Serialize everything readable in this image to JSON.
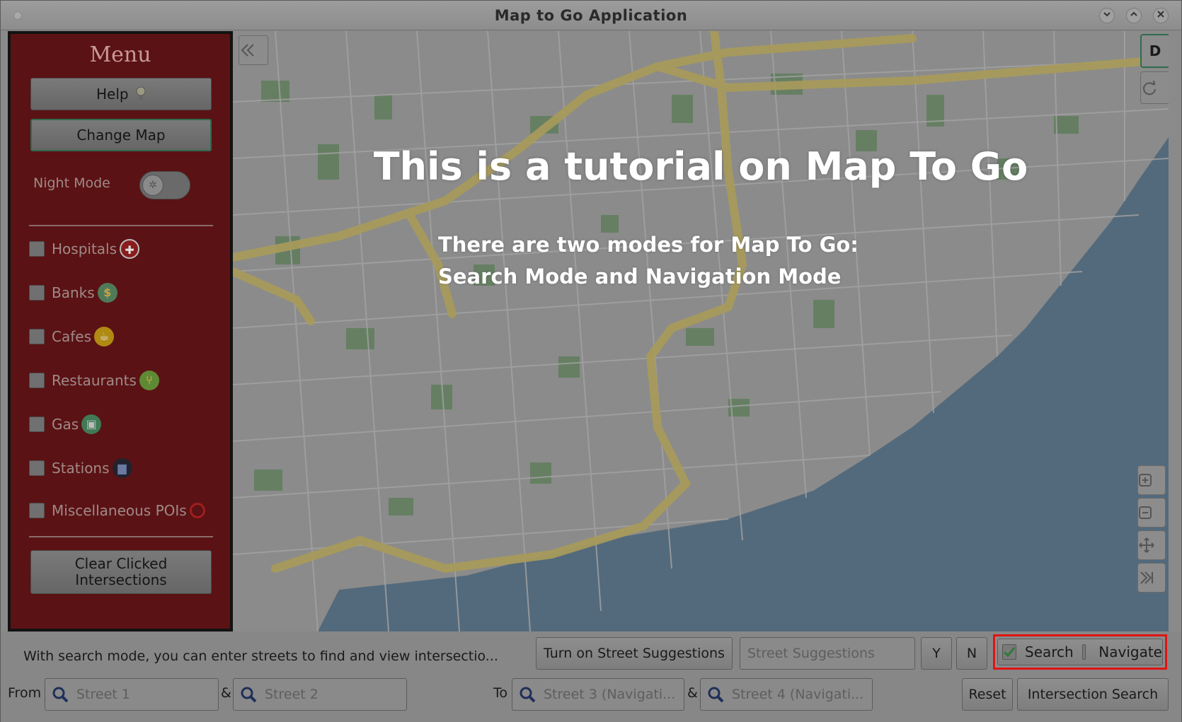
{
  "window": {
    "title": "Map to Go Application"
  },
  "sidebar": {
    "title": "Menu",
    "help_label": "Help",
    "change_map_label": "Change Map",
    "night_mode_label": "Night Mode",
    "pois": [
      {
        "label": "Hospitals",
        "icon": "hospital-icon",
        "color": "#a01e1e"
      },
      {
        "label": "Banks",
        "icon": "money-bag-icon",
        "color": "#5f8a5a"
      },
      {
        "label": "Cafes",
        "icon": "coffee-cup-icon",
        "color": "#b08a12"
      },
      {
        "label": "Restaurants",
        "icon": "fork-knife-icon",
        "color": "#5f8a35"
      },
      {
        "label": "Gas",
        "icon": "gas-pump-icon",
        "color": "#3f7a55"
      },
      {
        "label": "Stations",
        "icon": "train-icon",
        "color": "#2a2a3a"
      },
      {
        "label": "Miscellaneous POIs",
        "icon": "circle-marker-icon",
        "color": "#a01e1e"
      }
    ],
    "clear_label_line1": "Clear Clicked",
    "clear_label_line2": "Intersections"
  },
  "map": {
    "d_label": "D",
    "overlay_title": "This is a tutorial on Map To Go",
    "overlay_line1": "There are two modes for Map To Go:",
    "overlay_line2": "Search Mode and Navigation Mode"
  },
  "bottom": {
    "info_text": "With search mode, you can enter streets to find and view intersectio...",
    "suggestions_button": "Turn on Street Suggestions",
    "suggestions_placeholder": "Street Suggestions",
    "yes_label": "Y",
    "no_label": "N",
    "search_label": "Search",
    "navigate_label": "Navigate",
    "search_checked": true,
    "navigate_checked": false,
    "from_label": "From",
    "street1": "Street 1",
    "amp1": "&",
    "street2": "Street 2",
    "to_label": "To",
    "street3": "Street 3 (Navigati...",
    "amp2": "&",
    "street4": "Street 4 (Navigati...",
    "reset_label": "Reset",
    "intersection_search_label": "Intersection Search"
  },
  "colors": {
    "sidebar_bg": "#5b1214",
    "highlight": "#e01414",
    "accent_green": "#2f6b4e",
    "water": "#536a7c",
    "highway": "#a79a5c"
  }
}
